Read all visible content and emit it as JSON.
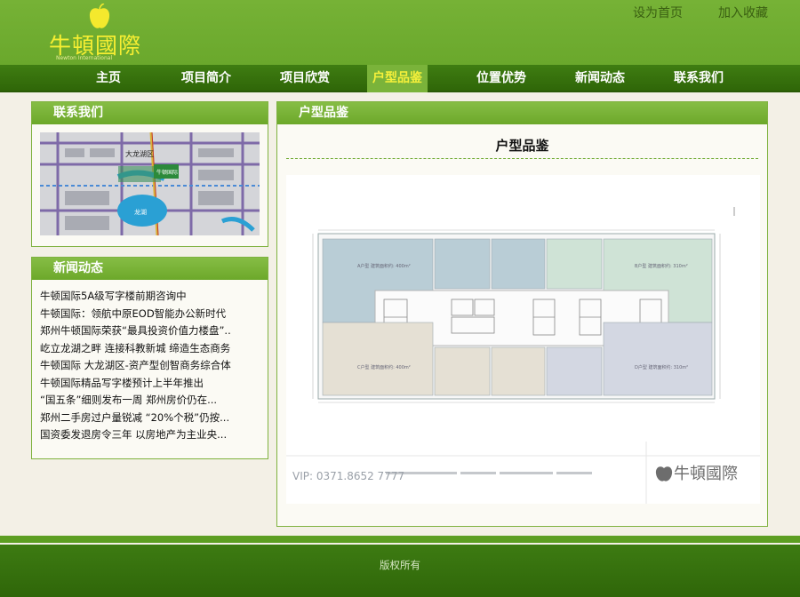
{
  "header": {
    "logo_text": "牛頓國際",
    "logo_subtext": "Newton International",
    "set_home": "设为首页",
    "add_favorite": "加入收藏"
  },
  "nav": {
    "items": [
      "主页",
      "项目简介",
      "项目欣赏",
      "户型品鉴",
      "位置优势",
      "新闻动态",
      "联系我们"
    ],
    "active": "户型品鉴"
  },
  "sidebar": {
    "contact_title": "联系我们",
    "map_labels": {
      "district": "大龙湖区",
      "lake": "龙湖",
      "brand": "牛顿国际"
    },
    "news_title": "新闻动态",
    "news_items": [
      "牛顿国际5A级写字楼前期咨询中",
      "牛顿国际：领航中原EOD智能办公新时代",
      "郑州牛顿国际荣获“最具投资价值力楼盘”..",
      "屹立龙湖之畔 连接科教新城 缔造生态商务",
      "牛顿国际 大龙湖区-资产型创智商务综合体",
      "牛顿国际精品写字楼预计上半年推出",
      "“国五条”细则发布一周 郑州房价仍在...",
      "郑州二手房过户量锐减 “20%个税”仍按...",
      "国资委发退房令三年 以房地产为主业央..."
    ]
  },
  "main": {
    "panel_title": "户型品鉴",
    "heading": "户型品鉴",
    "plan": {
      "vip": "VIP: 0371.8652 7777",
      "brand": "牛頓國際",
      "units": [
        {
          "label": "A户型  建筑面积约: 400m²",
          "color": "#b9cdd6"
        },
        {
          "label": "B户型  建筑面积约: 310m²",
          "color": "#cfe3d6"
        },
        {
          "label": "C户型  建筑面积约: 400m²",
          "color": "#e5e0d4"
        },
        {
          "label": "D户型  建筑面积约: 310m²",
          "color": "#d3d7e2"
        }
      ]
    }
  },
  "footer": {
    "copyright": "版权所有"
  }
}
